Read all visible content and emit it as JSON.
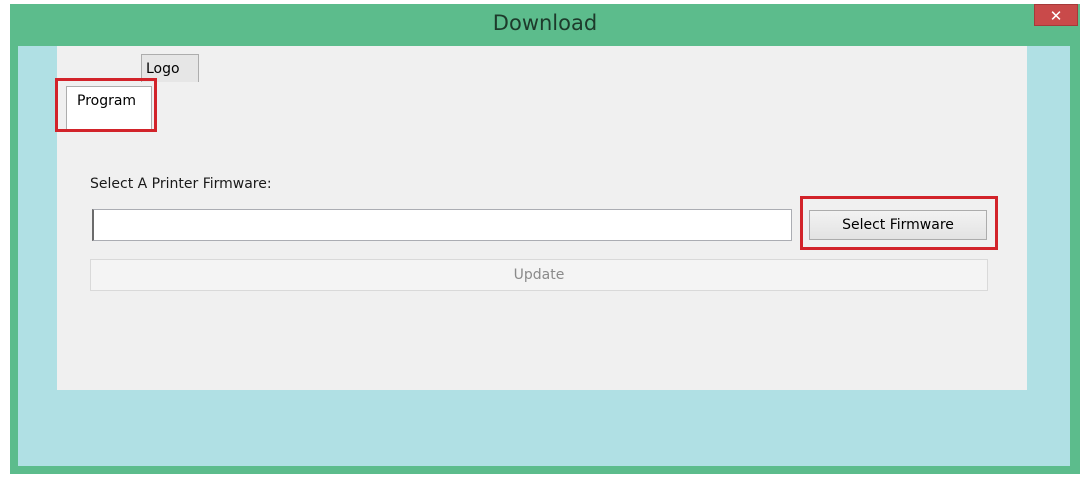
{
  "window": {
    "title": "Download",
    "close_glyph": "✕",
    "titlebar_color": "#5cbc8c",
    "client_color": "#b0e0e4",
    "highlight_color": "#d2232a"
  },
  "tabs": [
    {
      "label": "Program",
      "selected": true
    },
    {
      "label": "Logo",
      "selected": false
    }
  ],
  "program_tab": {
    "firmware_label": "Select A Printer Firmware:",
    "firmware_path_value": "",
    "select_button_label": "Select Firmware",
    "update_button_label": "Update",
    "update_enabled": false
  }
}
